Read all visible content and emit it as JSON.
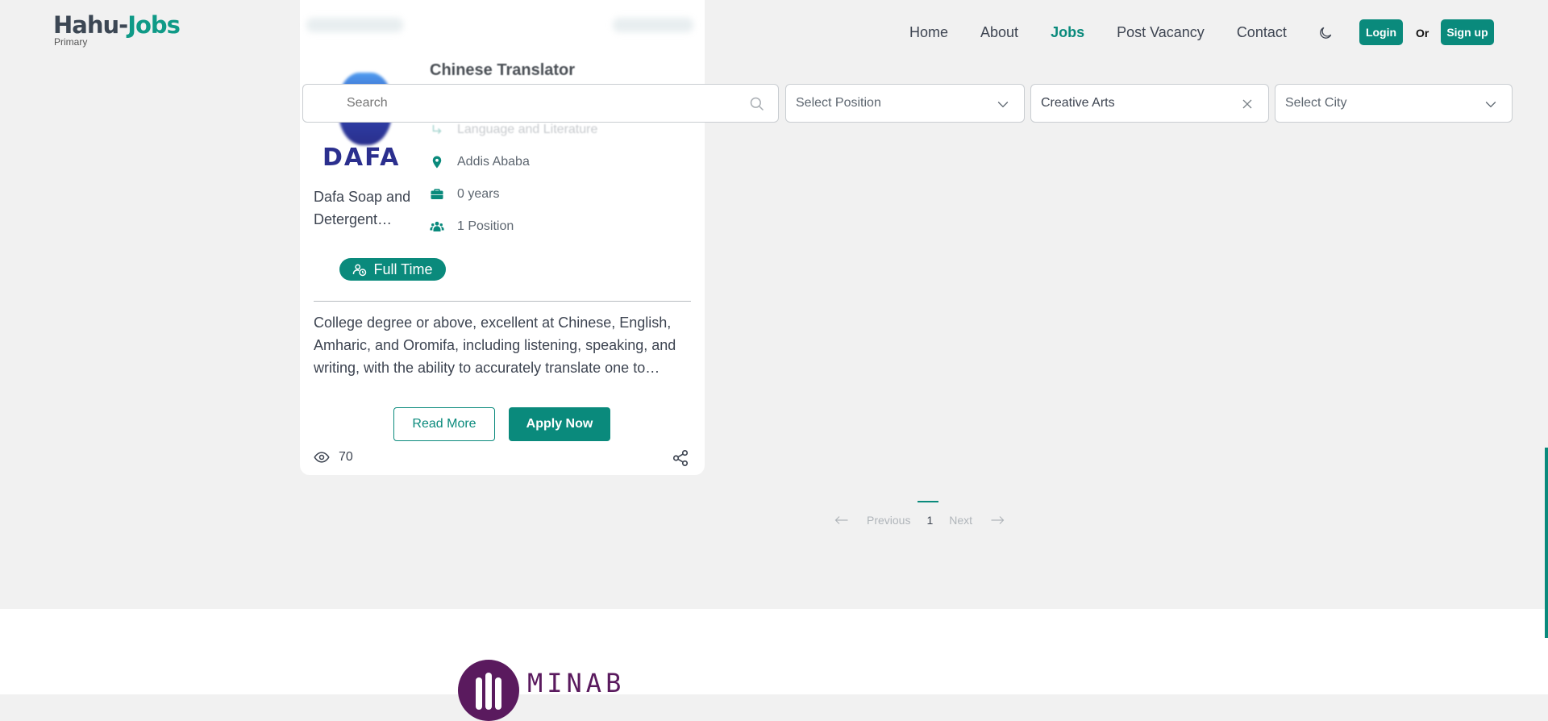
{
  "logo": {
    "part1": "Hahu",
    "sep": "-",
    "part2": "Jobs",
    "sub": "Primary"
  },
  "nav": {
    "home": "Home",
    "about": "About",
    "jobs": "Jobs",
    "post_vacancy": "Post Vacancy",
    "contact": "Contact"
  },
  "auth": {
    "login": "Login",
    "or": "Or",
    "signup": "Sign up"
  },
  "search": {
    "placeholder": "Search",
    "position_placeholder": "Select Position",
    "category_value": "Creative Arts",
    "city_placeholder": "Select City"
  },
  "job": {
    "title": "Chinese Translator",
    "category": "Language and Literature",
    "company_logo_text": "DAFA",
    "company": "Dafa Soap and Detergent…",
    "location": "Addis Ababa",
    "experience": "0 years",
    "positions": "1 Position",
    "employment_type": "Full Time",
    "description": "College degree or above, excellent at Chinese, English, Amharic, and Oromifa, including listening, speaking, and writing, with the ability to accurately translate one to…",
    "read_more": "Read More",
    "apply_now": "Apply Now",
    "views": "70"
  },
  "pagination": {
    "previous": "Previous",
    "current": "1",
    "next": "Next"
  },
  "footer": {
    "brand": "MINAB"
  },
  "colors": {
    "accent": "#0a8a7c",
    "background": "#f1f1f1",
    "footer_brand": "#5a1a5e"
  },
  "icons": [
    "moon-icon",
    "search-icon",
    "chevron-down-icon",
    "close-icon",
    "location-icon",
    "briefcase-icon",
    "users-icon",
    "user-clock-icon",
    "eye-icon",
    "share-icon",
    "arrow-left-icon",
    "arrow-right-icon"
  ]
}
